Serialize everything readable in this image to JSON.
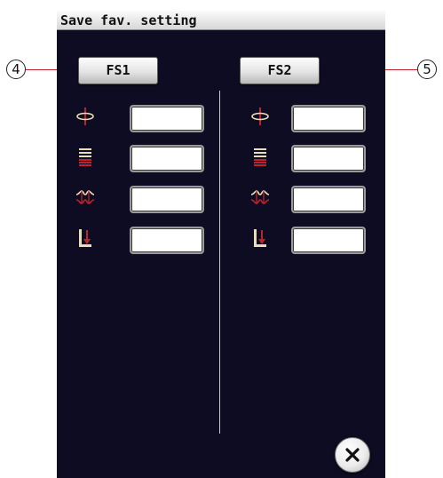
{
  "dialog": {
    "title": "Save fav. setting"
  },
  "callouts": [
    {
      "label": "4"
    },
    {
      "label": "5"
    }
  ],
  "columns": [
    {
      "button_label": "FS1",
      "fields": [
        "",
        "",
        "",
        ""
      ]
    },
    {
      "button_label": "FS2",
      "fields": [
        "",
        "",
        "",
        ""
      ]
    }
  ],
  "setting_icons": [
    "stitch-width-icon",
    "stitch-length-icon",
    "thread-tension-icon",
    "presser-foot-pressure-icon"
  ],
  "close_button": {
    "icon": "close-icon"
  },
  "colors": {
    "panel_background": "#0e0c22",
    "icon_red": "#c0222b",
    "icon_cream": "#e8ddb5",
    "divider": "#c9c9c9"
  }
}
